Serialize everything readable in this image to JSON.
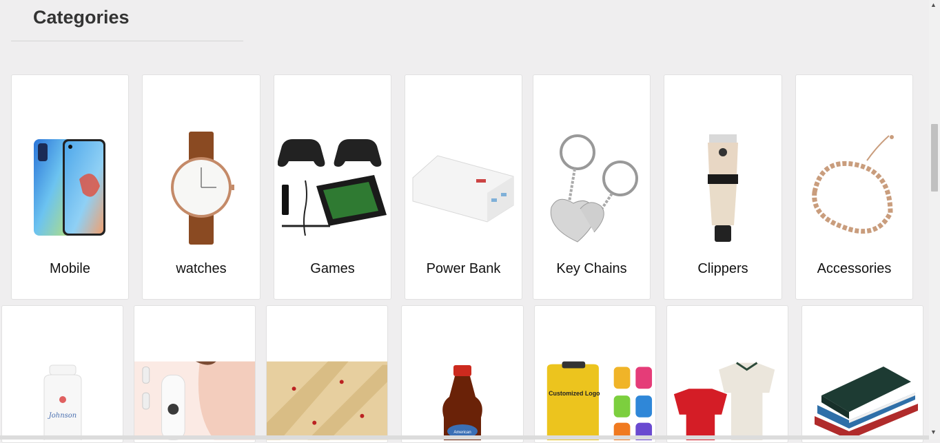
{
  "heading": "Categories",
  "categories_row1": [
    {
      "label": "Mobile",
      "icon": "mobile-phone-image"
    },
    {
      "label": "watches",
      "icon": "watch-image"
    },
    {
      "label": "Games",
      "icon": "game-console-image"
    },
    {
      "label": "Power Bank",
      "icon": "power-bank-image"
    },
    {
      "label": "Key Chains",
      "icon": "key-chain-image"
    },
    {
      "label": "Clippers",
      "icon": "hair-clipper-image"
    },
    {
      "label": "Accessories",
      "icon": "bracelet-image"
    }
  ],
  "categories_row2": [
    {
      "icon": "baby-powder-image"
    },
    {
      "icon": "pore-vacuum-image"
    },
    {
      "icon": "gift-wrap-image"
    },
    {
      "icon": "syrup-bottle-image",
      "text": "American"
    },
    {
      "icon": "backpacks-image",
      "text": "Customized Logo"
    },
    {
      "icon": "football-jerseys-image"
    },
    {
      "icon": "books-image"
    }
  ],
  "colors": {
    "background": "#efeeef",
    "card": "#ffffff",
    "text": "#111111"
  }
}
